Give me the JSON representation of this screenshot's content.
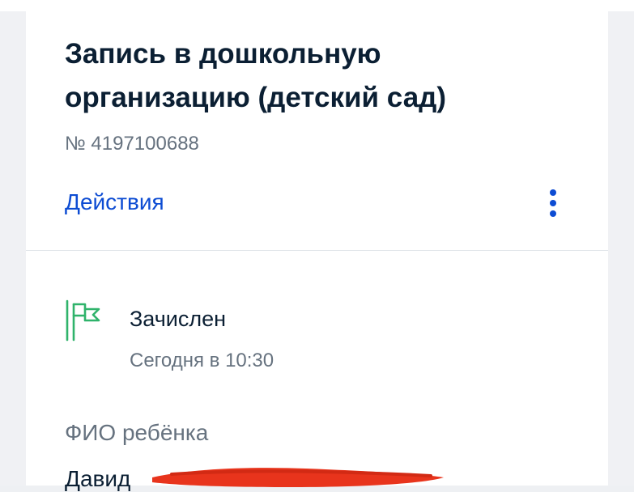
{
  "header": {
    "title": "Запись в дошкольную организацию (детский сад)",
    "application_number": "№ 4197100688",
    "actions_label": "Действия"
  },
  "status": {
    "label": "Зачислен",
    "time": "Сегодня в 10:30",
    "icon": "flag-icon",
    "icon_color": "#2fb36b"
  },
  "child": {
    "field_label": "ФИО ребёнка",
    "name_visible": "Давид"
  },
  "colors": {
    "accent": "#0d4cd3",
    "text_primary": "#0b1f33",
    "text_secondary": "#66727f",
    "redaction": "#e8341c"
  }
}
